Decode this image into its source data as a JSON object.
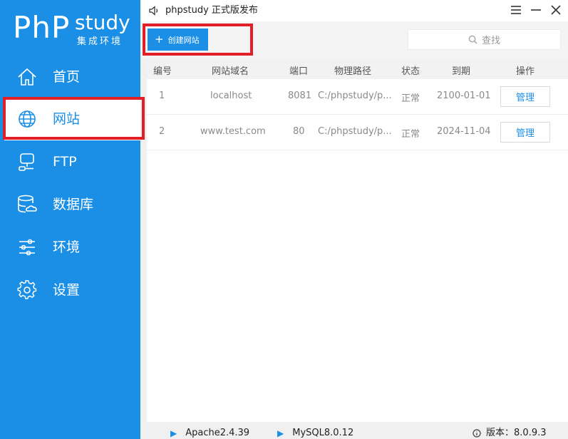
{
  "sidebar": {
    "logo": {
      "php": "PhP",
      "study": "study",
      "subtitle": "集成环境"
    },
    "items": [
      {
        "label": "首页",
        "icon": "home-icon"
      },
      {
        "label": "网站",
        "icon": "globe-icon",
        "active": true
      },
      {
        "label": "FTP",
        "icon": "ftp-icon"
      },
      {
        "label": "数据库",
        "icon": "database-icon"
      },
      {
        "label": "环境",
        "icon": "sliders-icon"
      },
      {
        "label": "设置",
        "icon": "gear-icon"
      }
    ]
  },
  "titlebar": {
    "title": "phpstudy 正式版发布"
  },
  "toolbar": {
    "create_label": "创建网站",
    "search_placeholder": "查找"
  },
  "table": {
    "headers": [
      "编号",
      "网站域名",
      "端口",
      "物理路径",
      "状态",
      "到期",
      "操作"
    ],
    "rows": [
      {
        "id": "1",
        "domain": "localhost",
        "port": "8081",
        "path": "C:/phpstudy/p...",
        "status": "正常",
        "expiry": "2100-01-01",
        "action": "管理"
      },
      {
        "id": "2",
        "domain": "www.test.com",
        "port": "80",
        "path": "C:/phpstudy/p...",
        "status": "正常",
        "expiry": "2024-11-04",
        "action": "管理"
      }
    ]
  },
  "statusbar": {
    "services": [
      "Apache2.4.39",
      "MySQL8.0.12"
    ],
    "version_label": "版本：",
    "version": "8.0.9.3"
  },
  "colors": {
    "accent": "#1b8fe6",
    "highlight": "#e21f26"
  }
}
